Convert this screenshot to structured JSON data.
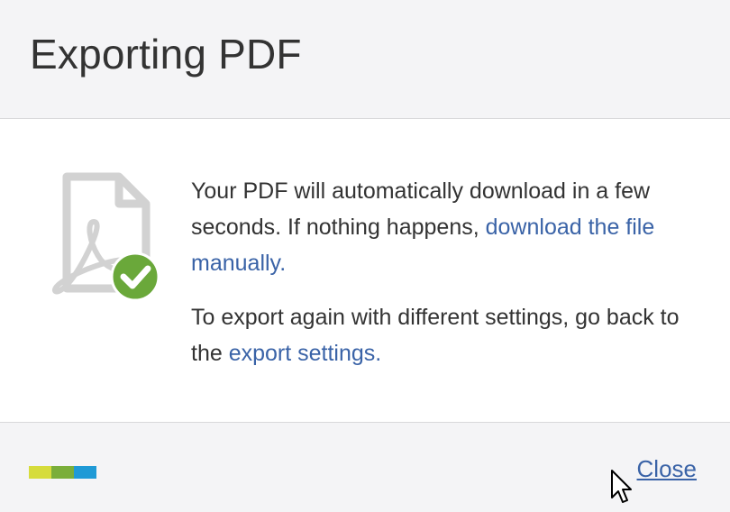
{
  "dialog": {
    "title": "Exporting PDF",
    "message": {
      "line1_text": "Your PDF will automatically download in a few seconds. If nothing happens, ",
      "line1_link": "download the file manually",
      "line1_end": ".",
      "line2_text": "To export again with different settings, go back to the ",
      "line2_link": "export settings",
      "line2_end": "."
    },
    "close_label": "Close"
  },
  "icons": {
    "pdf": "pdf-file-icon",
    "check": "check-circle-icon",
    "cursor": "mouse-pointer-icon"
  },
  "colors": {
    "link": "#3a63a7",
    "check_green": "#6aa83a",
    "file_gray": "#d2d2d2",
    "brand": [
      "#d6dc3c",
      "#7aae3a",
      "#1f9ad6"
    ]
  }
}
